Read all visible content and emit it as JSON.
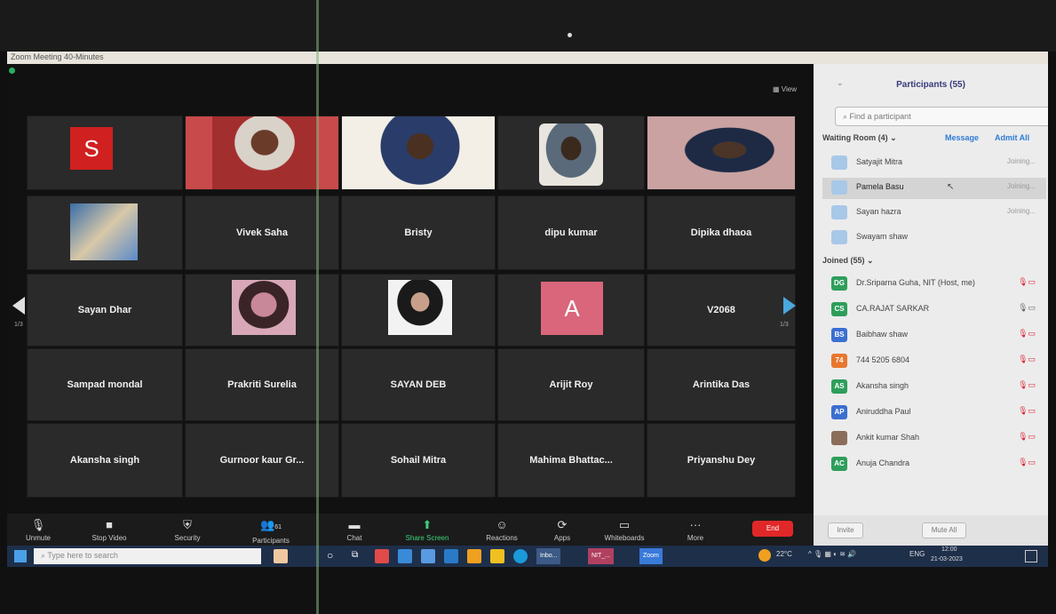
{
  "window": {
    "title": "Zoom Meeting 40-Minutes"
  },
  "view_label": "View",
  "pagination": {
    "left": "1/3",
    "right": "1/3"
  },
  "tiles": {
    "s_avatar": {
      "letter": "S",
      "color": "#d02020"
    },
    "vivek": "Vivek Saha",
    "bristy": "Bristy",
    "dipu": "dipu kumar",
    "dipika": "Dipika dhaoa",
    "sayan_dhar": "Sayan Dhar",
    "prakriti": "Prakriti Surelia",
    "sayan_deb": "SAYAN DEB",
    "arijit": "Arijit Roy",
    "a_avatar": {
      "letter": "A",
      "color": "#d9667a"
    },
    "v2068": "V2068",
    "sampad": "Sampad mondal",
    "arintika": "Arintika Das",
    "akansha": "Akansha singh",
    "gurnoor": "Gurnoor kaur Gr...",
    "sohail": "Sohail Mitra",
    "mahima": "Mahima Bhattac...",
    "priyanshu": "Priyanshu Dey"
  },
  "toolbar": {
    "unmute": "Unmute",
    "stop_video": "Stop Video",
    "security": "Security",
    "participants": "Participants",
    "participants_count": "61",
    "chat": "Chat",
    "share_screen": "Share Screen",
    "reactions": "Reactions",
    "apps": "Apps",
    "whiteboards": "Whiteboards",
    "more": "More",
    "end": "End"
  },
  "panel": {
    "title": "Participants (55)",
    "search_placeholder": "Find a participant",
    "waiting_room": "Waiting Room (4)",
    "message": "Message",
    "admit_all": "Admit All",
    "waiting": [
      {
        "name": "Satyajit Mitra",
        "status": "Joining..."
      },
      {
        "name": "Pamela Basu",
        "status": "Joining..."
      },
      {
        "name": "Sayan hazra",
        "status": "Joining..."
      },
      {
        "name": "Swayam shaw",
        "status": ""
      }
    ],
    "joined_label": "Joined (55)",
    "joined": [
      {
        "initials": "DG",
        "name": "Dr.Sriparna Guha, NIT (Host, me)",
        "color": "#2e9e5b"
      },
      {
        "initials": "CS",
        "name": "CA.RAJAT SARKAR",
        "color": "#2e9e5b"
      },
      {
        "initials": "BS",
        "name": "Baibhaw shaw",
        "color": "#3b6fd1"
      },
      {
        "initials": "74",
        "name": "744 5205 6804",
        "color": "#e8772e"
      },
      {
        "initials": "AS",
        "name": "Akansha singh",
        "color": "#2e9e5b"
      },
      {
        "initials": "AP",
        "name": "Aniruddha Paul",
        "color": "#3b6fd1"
      },
      {
        "initials": "",
        "name": "Ankit kumar Shah",
        "color": "#8a6e5a"
      },
      {
        "initials": "AC",
        "name": "Anuja Chandra",
        "color": "#2e9e5b"
      }
    ],
    "invite": "Invite",
    "mute_all": "Mute All"
  },
  "taskbar": {
    "search_placeholder": "Type here to search",
    "inbox": "Inbo...",
    "nit": "NIT_...",
    "zoom": "Zoom",
    "weather": "22°C",
    "lang": "ENG",
    "time": "12:00",
    "date": "21-03-2023"
  }
}
